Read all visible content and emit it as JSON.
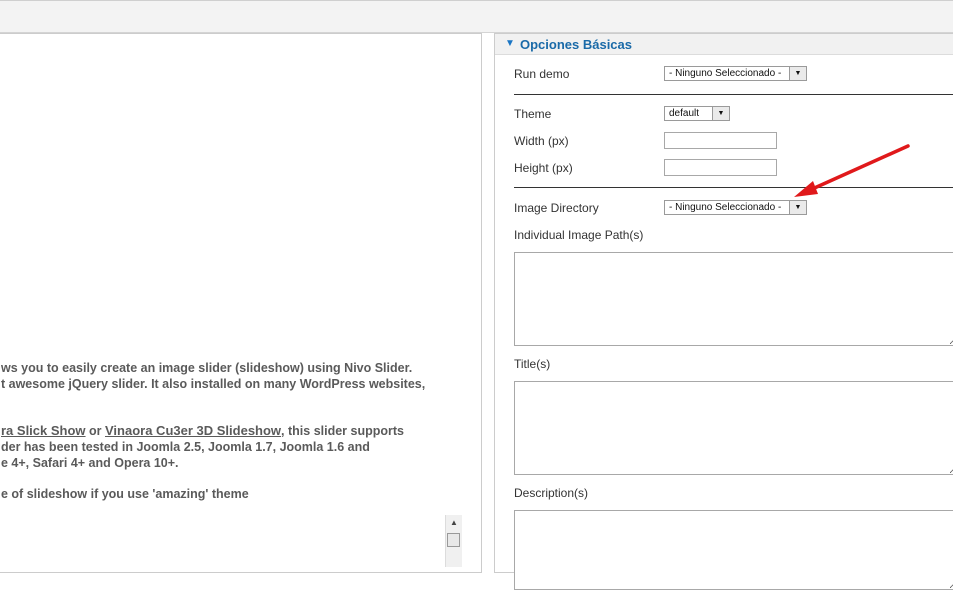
{
  "left": {
    "desc_lines": [
      "ws you to easily create an image slider (slideshow) using Nivo Slider.",
      "t awesome jQuery slider. It also installed on many WordPress websites,"
    ],
    "link1": "ra Slick Show",
    "or_text": " or ",
    "link2": "Vinaora Cu3er 3D Slideshow",
    "after_links": ", this slider supports",
    "tested_line": "der has been tested in Joomla 2.5, Joomla 1.7, Joomla 1.6 and",
    "browsers_line": "e 4+, Safari 4+ and Opera 10+.",
    "theme_line": "e of slideshow if you use 'amazing' theme",
    "scroll_up": "▲"
  },
  "panel": {
    "title": "Opciones Básicas",
    "toggle_icon": "▼",
    "run_demo_label": "Run demo",
    "run_demo_value": "- Ninguno Seleccionado -",
    "theme_label": "Theme",
    "theme_value": "default",
    "width_label": "Width (px)",
    "width_value": "",
    "height_label": "Height (px)",
    "height_value": "",
    "image_dir_label": "Image Directory",
    "image_dir_value": "- Ninguno Seleccionado -",
    "image_paths_label": "Individual Image Path(s)",
    "titles_label": "Title(s)",
    "descriptions_label": "Description(s)",
    "select_arrow": "▼"
  },
  "colors": {
    "annotation_arrow": "#e0191b",
    "panel_title": "#1a6aa8"
  }
}
